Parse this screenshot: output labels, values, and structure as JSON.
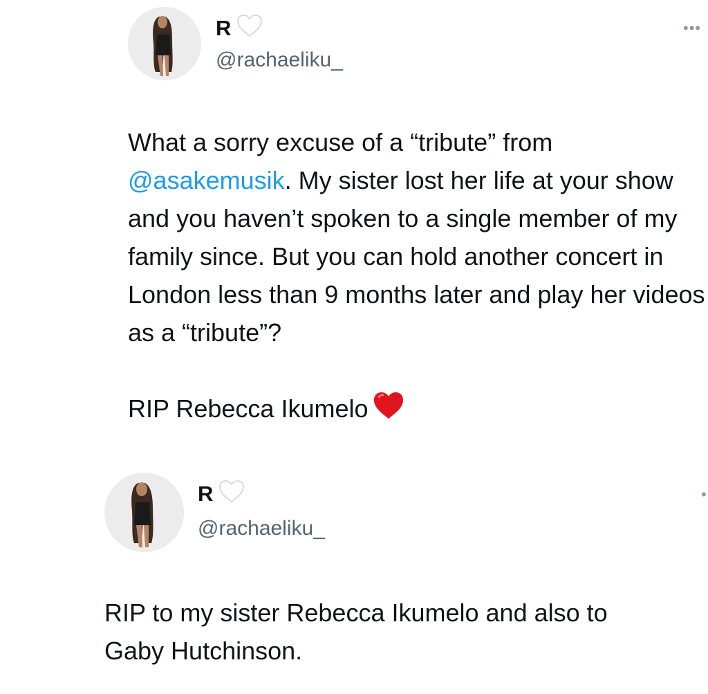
{
  "tweets": [
    {
      "display_name": "R",
      "handle": "@rachaeliku_",
      "more_label": "•••",
      "body_before_mention": "What a sorry excuse of a “tribute” from ",
      "mention": "@asakemusik",
      "body_after_mention": ". My sister lost her life at your show and you haven’t spoken to a single member of my family since. But you can hold another concert in London less than 9 months later and play her videos as a “tribute”?",
      "rip_line": "RIP Rebecca Ikumelo"
    },
    {
      "display_name": "R",
      "handle": "@rachaeliku_",
      "more_label": "•",
      "body": "RIP to my sister Rebecca Ikumelo and also to\nGaby Hutchinson."
    }
  ],
  "icons": {
    "name_badge": "white-heart-icon",
    "rip_emoji": "red-heart-icon",
    "more": "more-options-icon"
  },
  "colors": {
    "mention": "#1d9bf0",
    "handle": "#536471",
    "text": "#0f1419",
    "red_heart": "#e0141e"
  }
}
